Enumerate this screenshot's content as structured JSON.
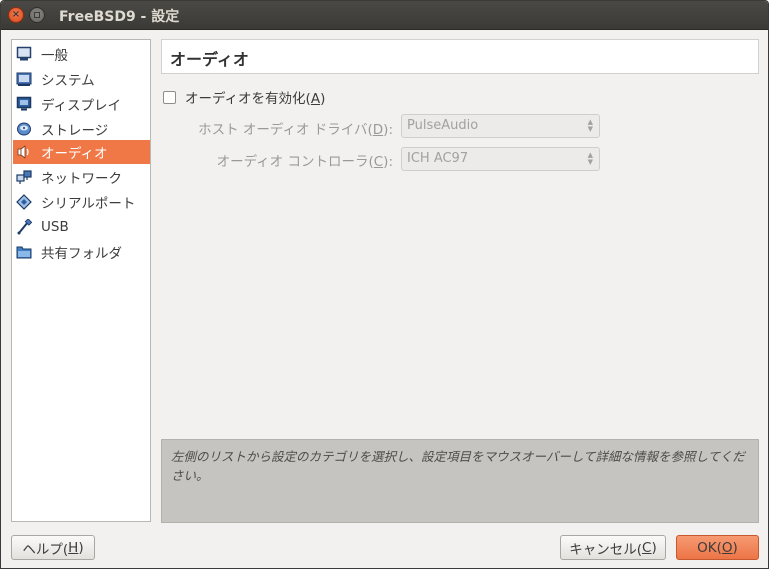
{
  "window": {
    "title": "FreeBSD9 - 設定"
  },
  "sidebar": {
    "items": [
      {
        "label": "一般",
        "icon": "monitor-icon"
      },
      {
        "label": "システム",
        "icon": "chip-icon"
      },
      {
        "label": "ディスプレイ",
        "icon": "display-icon"
      },
      {
        "label": "ストレージ",
        "icon": "disk-icon"
      },
      {
        "label": "オーディオ",
        "icon": "speaker-icon",
        "active": true
      },
      {
        "label": "ネットワーク",
        "icon": "network-icon"
      },
      {
        "label": "シリアルポート",
        "icon": "serial-port-icon"
      },
      {
        "label": "USB",
        "icon": "usb-icon"
      },
      {
        "label": "共有フォルダ",
        "icon": "folder-icon"
      }
    ]
  },
  "main": {
    "title": "オーディオ",
    "enable_audio": {
      "label_prefix": "オーディオを有効化(",
      "mnemonic": "A",
      "label_suffix": ")",
      "checked": false
    },
    "host_driver": {
      "label_prefix": "ホスト オーディオ ドライバ(",
      "mnemonic": "D",
      "label_suffix": "):",
      "value": "PulseAudio"
    },
    "controller": {
      "label_prefix": "オーディオ コントローラ(",
      "mnemonic": "C",
      "label_suffix": "):",
      "value": "ICH AC97"
    },
    "info_text": "左側のリストから設定のカテゴリを選択し、設定項目をマウスオーバーして詳細な情報を参照してください。"
  },
  "buttons": {
    "help": {
      "prefix": "ヘルプ(",
      "mnemonic": "H",
      "suffix": ")"
    },
    "cancel": {
      "prefix": "キャンセル(",
      "mnemonic": "C",
      "suffix": ")"
    },
    "ok": {
      "prefix": "OK(",
      "mnemonic": "O",
      "suffix": ")"
    }
  },
  "colors": {
    "accent": "#f07746",
    "titlebar": "#3b3a36",
    "background": "#f2f1f0"
  }
}
